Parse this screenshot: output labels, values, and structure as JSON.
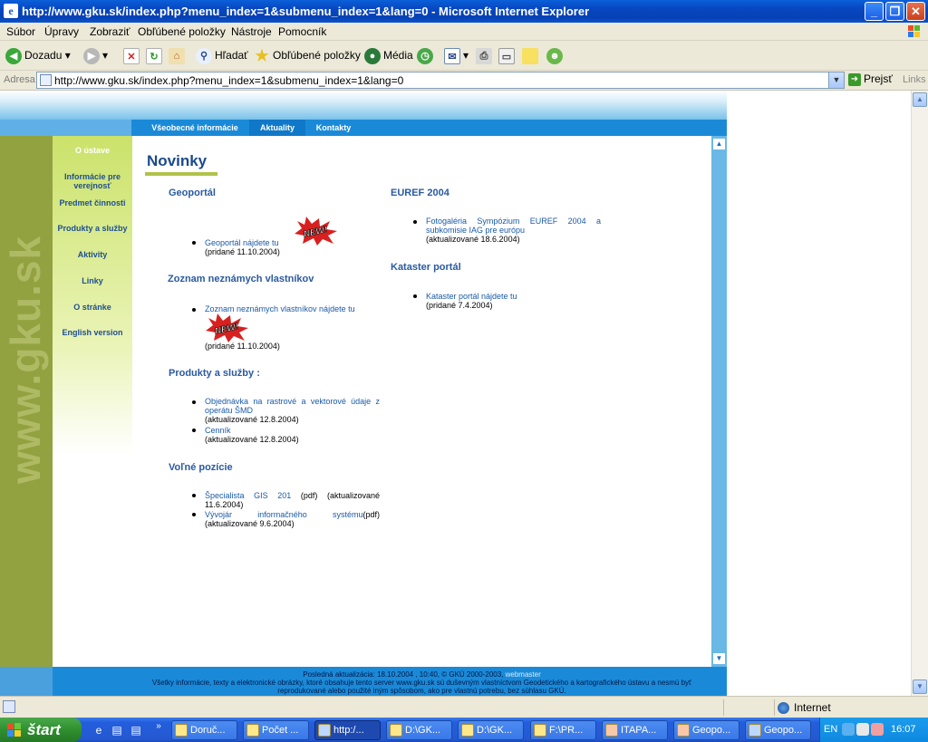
{
  "window": {
    "title": "http://www.gku.sk/index.php?menu_index=1&submenu_index=1&lang=0 - Microsoft Internet Explorer"
  },
  "menubar": [
    "Súbor",
    "Úpravy",
    "Zobraziť",
    "Obľúbené položky",
    "Nástroje",
    "Pomocník"
  ],
  "toolbar": {
    "back": "Dozadu",
    "search": "Hľadať",
    "favorites": "Obľúbené položky",
    "media": "Média"
  },
  "address": {
    "label": "Adresa",
    "url": "http://www.gku.sk/index.php?menu_index=1&submenu_index=1&lang=0",
    "go": "Prejsť",
    "links": "Links"
  },
  "page": {
    "watermark": "www.gku.sk",
    "tabs": [
      "Všeobecné informácie",
      "Aktuality",
      "Kontakty"
    ],
    "active_tab": "Aktuality",
    "sidebar": [
      "O ústave",
      "Informácie pre verejnosť",
      "Predmet činnosti",
      "Produkty a služby",
      "Aktivity",
      "Linky",
      "O stránke",
      "English version"
    ],
    "heading": "Novinky",
    "sections": {
      "geoportal": {
        "title": "Geoportál",
        "link": "Geoportál nájdete tu",
        "note": "(pridané 11.10.2004)"
      },
      "zoznam": {
        "title": "Zoznam neznámych vlastníkov",
        "link": "Zoznam neznámych vlastníkov nájdete tu",
        "note": "(pridané 11.10.2004)"
      },
      "produkty": {
        "title": "Produkty a služby :",
        "item1_link": "Objednávka na rastrové a vektorové údaje z operátu ŠMD",
        "item1_note": "(aktualizované 12.8.2004)",
        "item2_link": "Cenník",
        "item2_note": "(aktualizované 12.8.2004)"
      },
      "pozicie": {
        "title": "Voľné pozície",
        "item1_link": "Špecialista GIS 201",
        "item1_rest": "(pdf) (aktualizované 11.6.2004)",
        "item2_link": "Vývojár informačného systému",
        "item2_rest": "(pdf) (aktualizované 9.6.2004)"
      },
      "euref": {
        "title": "EUREF 2004",
        "link": "Fotogaléria Sympózium EUREF 2004 a subkomisie IAG pre európu",
        "note": "(aktualizované 18.6.2004)"
      },
      "kataster": {
        "title": "Kataster portál",
        "link": "Kataster portál nájdete tu",
        "note": "(pridané 7.4.2004)"
      }
    },
    "new_badge": "NEW!",
    "footer": {
      "line1": "Posledná aktualizácia: 18.10.2004 , 10:40, © GKÚ 2000-2003,",
      "webmaster": "webmaster",
      "line2": "Všetky informácie, texty a elektronické obrázky, ktoré obsahuje tento server www.gku.sk sú duševným vlastníctvom Geodetického a kartografického ústavu a nesmú byť reprodukované alebo použité iným spôsobom, ako pre vlastnú potrebu, bez súhlasu GKÚ."
    }
  },
  "statusbar": {
    "zone": "Internet"
  },
  "taskbar": {
    "start": "štart",
    "chevron": "»",
    "tasks": [
      "Doruč...",
      "Počet ...",
      "http:/...",
      "D:\\GK...",
      "D:\\GK...",
      "F:\\PR...",
      "ITAPA...",
      "Geopo...",
      "Geopo..."
    ],
    "lang": "EN",
    "clock": "16:07"
  },
  "colors": {
    "accent_blue": "#1a8ad8",
    "olive": "#93a240",
    "link": "#1a5aa8",
    "heading": "#1a4a8c"
  }
}
